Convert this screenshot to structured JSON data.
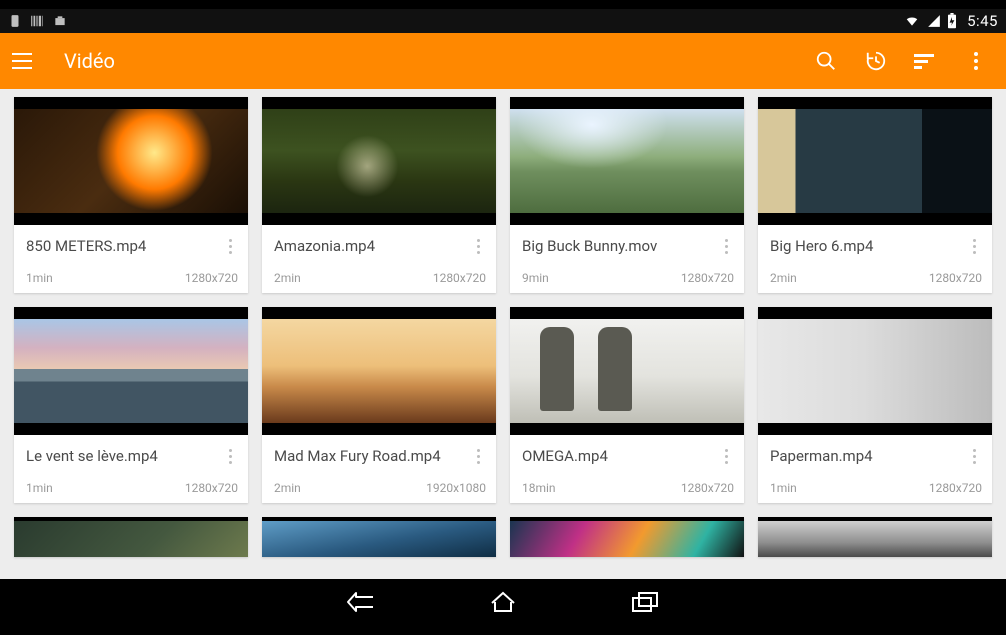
{
  "statusbar": {
    "time": "5:45"
  },
  "appbar": {
    "title": "Vidéo"
  },
  "videos": [
    {
      "title": "850 METERS.mp4",
      "duration": "1min",
      "resolution": "1280x720"
    },
    {
      "title": "Amazonia.mp4",
      "duration": "2min",
      "resolution": "1280x720"
    },
    {
      "title": "Big Buck Bunny.mov",
      "duration": "9min",
      "resolution": "1280x720"
    },
    {
      "title": "Big Hero 6.mp4",
      "duration": "2min",
      "resolution": "1280x720"
    },
    {
      "title": "Le vent se lève.mp4",
      "duration": "1min",
      "resolution": "1280x720"
    },
    {
      "title": "Mad Max Fury Road.mp4",
      "duration": "2min",
      "resolution": "1920x1080"
    },
    {
      "title": "OMEGA.mp4",
      "duration": "18min",
      "resolution": "1280x720"
    },
    {
      "title": "Paperman.mp4",
      "duration": "1min",
      "resolution": "1280x720"
    }
  ],
  "colors": {
    "accent": "#ff8800"
  }
}
